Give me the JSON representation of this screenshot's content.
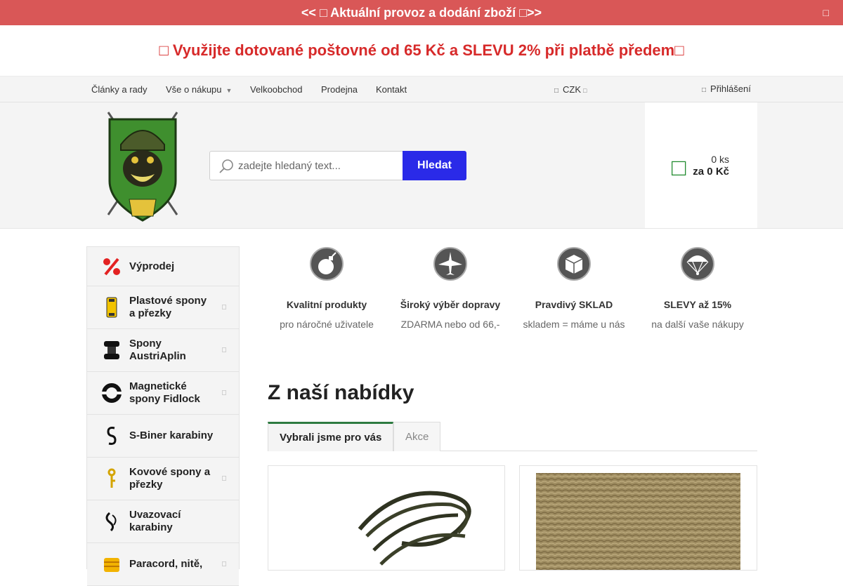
{
  "topbar": {
    "text": "<< □ Aktuální provoz a dodání zboží □>>",
    "close": "□"
  },
  "promo": {
    "text": "□ Využijte dotované poštovné od 65 Kč a SLEVU 2% při platbě předem□"
  },
  "nav": {
    "items": [
      {
        "label": "Články a rady",
        "has_dropdown": false
      },
      {
        "label": "Vše o nákupu",
        "has_dropdown": true
      },
      {
        "label": "Velkoobchod",
        "has_dropdown": false
      },
      {
        "label": "Prodejna",
        "has_dropdown": false
      },
      {
        "label": "Kontakt",
        "has_dropdown": false
      }
    ],
    "currency": "CZK",
    "login": "Přihlášení",
    "glyph": "□"
  },
  "search": {
    "placeholder": "zadejte hledaný text...",
    "button_label": "Hledat"
  },
  "cart": {
    "icon": "□",
    "count": "0 ks",
    "total": "za 0 Kč"
  },
  "sidebar": {
    "categories": [
      {
        "label": "Výprodej",
        "icon": "percent-icon",
        "has_submenu": false
      },
      {
        "label": "Plastové spony a přezky",
        "icon": "buckle-icon",
        "has_submenu": true
      },
      {
        "label": "Spony AustriAplin",
        "icon": "austrialpin-buckle-icon",
        "has_submenu": true
      },
      {
        "label": "Magnetické spony Fidlock",
        "icon": "magnet-ring-icon",
        "has_submenu": true
      },
      {
        "label": "S-Biner karabiny",
        "icon": "s-biner-icon",
        "has_submenu": false
      },
      {
        "label": "Kovové spony a přezky",
        "icon": "metal-buckle-icon",
        "has_submenu": true
      },
      {
        "label": "Uvazovací karabiny",
        "icon": "carabiner-icon",
        "has_submenu": false
      },
      {
        "label": "Paracord, nitě,",
        "icon": "paracord-icon",
        "has_submenu": true
      }
    ],
    "arrow_glyph": "□"
  },
  "features": [
    {
      "title": "Kvalitní produkty",
      "subtitle": "pro náročné uživatele",
      "icon": "bomb-icon"
    },
    {
      "title": "Široký výběr dopravy",
      "subtitle": "ZDARMA nebo od 66,-",
      "icon": "airplane-icon"
    },
    {
      "title": "Pravdivý SKLAD",
      "subtitle": "skladem = máme u nás",
      "icon": "box-icon"
    },
    {
      "title": "SLEVY až 15%",
      "subtitle": "na další vaše nákupy",
      "icon": "parachute-icon"
    }
  ],
  "offer": {
    "title": "Z naší nabídky",
    "tabs": [
      {
        "label": "Vybrali jsme pro vás",
        "active": true
      },
      {
        "label": "Akce",
        "active": false
      }
    ]
  },
  "colors": {
    "topbar": "#d95757",
    "promo_text": "#d72a2a",
    "search_button": "#2a2ae8",
    "cart_icon": "#1f8a2d",
    "tab_accent": "#2d7a40"
  }
}
